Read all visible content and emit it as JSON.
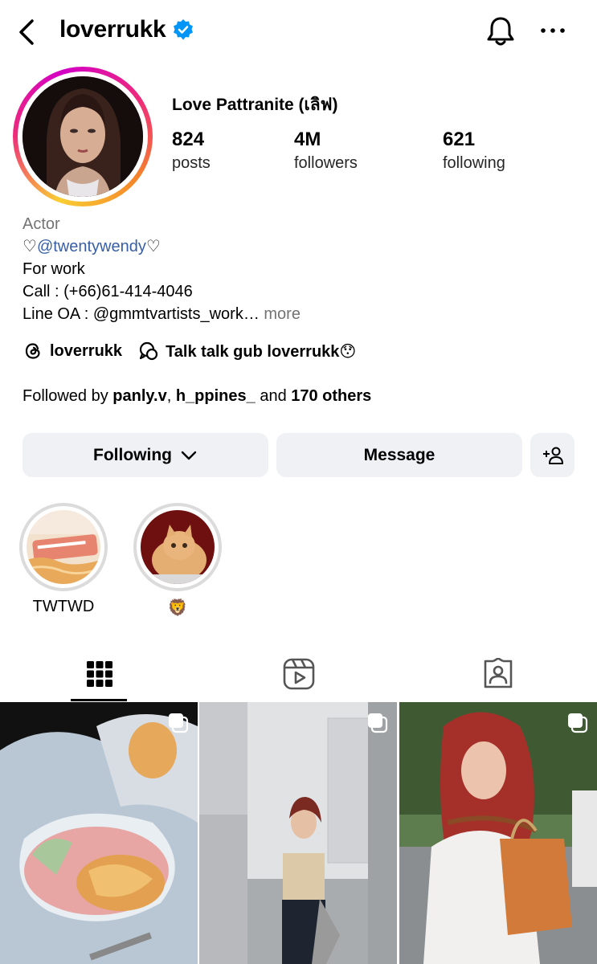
{
  "header": {
    "username": "loverrukk"
  },
  "profile": {
    "full_name": "Love Pattranite (เลิฟ)",
    "stats": [
      {
        "value": "824",
        "label": "posts"
      },
      {
        "value": "4M",
        "label": "followers"
      },
      {
        "value": "621",
        "label": "following"
      }
    ]
  },
  "bio": {
    "category": "Actor",
    "heart_left": "♡",
    "mention": "@twentywendy",
    "heart_right": "♡",
    "line2": "For work",
    "line3": "Call : (+66)61-414-4046",
    "line4": "Line OA : @gmmtvartists_work…",
    "more": "more"
  },
  "links": {
    "threads": "loverrukk",
    "channel": "Talk talk gub loverrukk😯"
  },
  "followed_by": {
    "prefix": "Followed by ",
    "user1": "panly.v",
    "sep": ", ",
    "user2": "h_ppines_",
    "and": " and ",
    "others": "170 others"
  },
  "buttons": {
    "following": "Following",
    "message": "Message"
  },
  "highlights": [
    {
      "label": "TWTWD"
    },
    {
      "label": "🦁"
    }
  ],
  "colors": {
    "verified": "#0095f6",
    "button_bg": "#eff1f4",
    "secondary_text": "#737373",
    "mention": "#385fa6"
  }
}
